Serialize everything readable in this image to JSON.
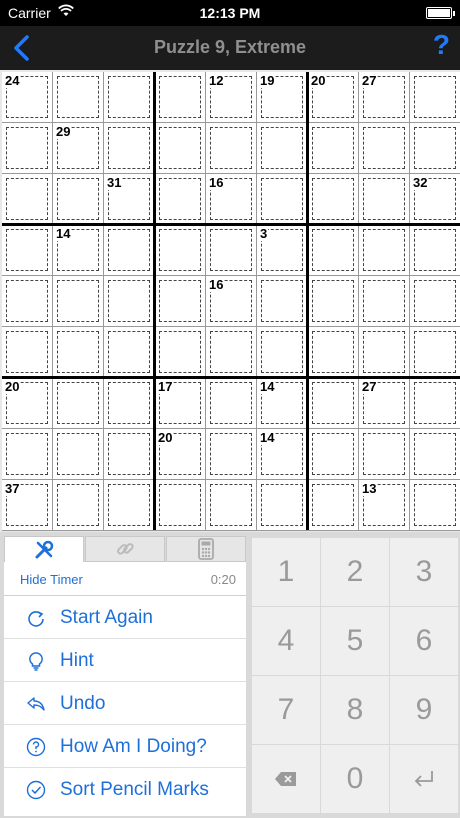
{
  "status_bar": {
    "carrier": "Carrier",
    "time": "12:13 PM"
  },
  "nav": {
    "title": "Puzzle 9, Extreme",
    "help_label": "?"
  },
  "cage_sums": [
    "24",
    "12",
    "19",
    "20",
    "27",
    "29",
    "31",
    "16",
    "32",
    "14",
    "3",
    "16",
    "20",
    "17",
    "14",
    "27",
    "20",
    "14",
    "37",
    "13"
  ],
  "tabs": [
    {
      "icon": "tools-icon",
      "active": true
    },
    {
      "icon": "link-icon",
      "active": false
    },
    {
      "icon": "calculator-icon",
      "active": false
    }
  ],
  "timer": {
    "hide_label": "Hide Timer",
    "value": "0:20"
  },
  "menu": [
    {
      "label": "Start Again",
      "icon": "restart-icon"
    },
    {
      "label": "Hint",
      "icon": "lightbulb-icon"
    },
    {
      "label": "Undo",
      "icon": "undo-icon"
    },
    {
      "label": "How Am I Doing?",
      "icon": "question-circle-icon"
    },
    {
      "label": "Sort Pencil Marks",
      "icon": "checkmark-circle-icon"
    }
  ],
  "keypad": {
    "digits": [
      "1",
      "2",
      "3",
      "4",
      "5",
      "6",
      "7",
      "8",
      "9"
    ],
    "zero": "0",
    "delete_icon": "backspace-icon",
    "enter_icon": "return-icon"
  },
  "colors": {
    "accent": "#1e6fd9",
    "nav_background": "#1c1c1c",
    "help": "#1e7bff"
  }
}
